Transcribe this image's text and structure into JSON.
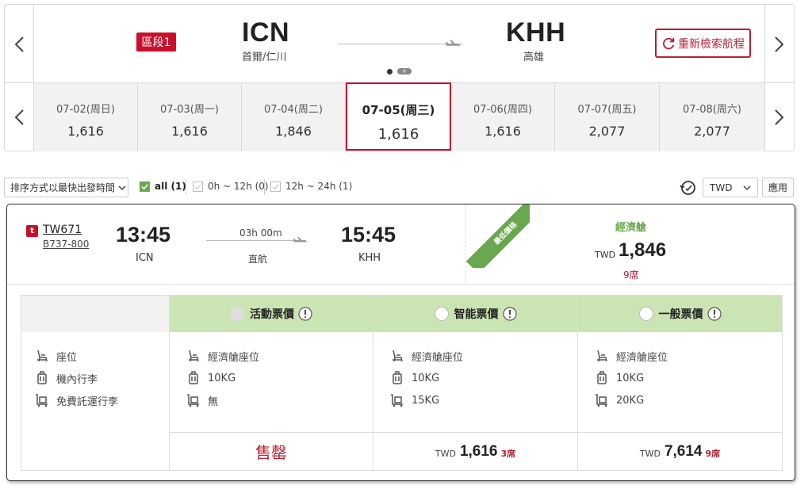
{
  "route": {
    "segment_label": "區段1",
    "origin_code": "ICN",
    "origin_name": "首爾/仁川",
    "destination_code": "KHH",
    "destination_name": "高雄",
    "research_label": "重新檢索航程"
  },
  "dates": [
    {
      "label": "07-02(周日)",
      "price": "1,616"
    },
    {
      "label": "07-03(周一)",
      "price": "1,616"
    },
    {
      "label": "07-04(周二)",
      "price": "1,846"
    },
    {
      "label": "07-05(周三)",
      "price": "1,616",
      "selected": true
    },
    {
      "label": "07-06(周四)",
      "price": "1,616"
    },
    {
      "label": "07-07(周五)",
      "price": "2,077"
    },
    {
      "label": "07-08(周六)",
      "price": "2,077"
    }
  ],
  "filters": {
    "sort_label": "排序方式以最快出發時間",
    "options": [
      {
        "label": "all (1)",
        "checked": true
      },
      {
        "label": "0h ~ 12h (0)",
        "checked": false
      },
      {
        "label": "12h ~ 24h (1)",
        "checked": false
      }
    ],
    "currency": "TWD",
    "apply_label": "應用"
  },
  "flight": {
    "flight_no": "TW671",
    "aircraft": "B737-800",
    "depart_time": "13:45",
    "depart_airport": "ICN",
    "duration": "03h 00m",
    "stops": "直航",
    "arrive_time": "15:45",
    "arrive_airport": "KHH",
    "ribbon": "最低價格",
    "cabin": "經濟艙",
    "currency": "TWD",
    "price": "1,846",
    "seats": "9席"
  },
  "features": {
    "seat": "座位",
    "cabin_baggage": "機內行李",
    "checked_baggage": "免費託運行李"
  },
  "fares": [
    {
      "name": "活動票價",
      "seat": "經濟艙座位",
      "cabin_baggage": "10KG",
      "checked_baggage": "無",
      "sold_out": "售罄",
      "available": false
    },
    {
      "name": "智能票價",
      "seat": "經濟艙座位",
      "cabin_baggage": "10KG",
      "checked_baggage": "15KG",
      "currency": "TWD",
      "price": "1,616",
      "seats": "3席",
      "available": true
    },
    {
      "name": "一般票價",
      "seat": "經濟艙座位",
      "cabin_baggage": "10KG",
      "checked_baggage": "20KG",
      "currency": "TWD",
      "price": "7,614",
      "seats": "9席",
      "available": true
    }
  ],
  "colors": {
    "brand_red": "#c8102e",
    "fare_green": "#cbe4b4",
    "ribbon_green": "#6aa84f"
  }
}
